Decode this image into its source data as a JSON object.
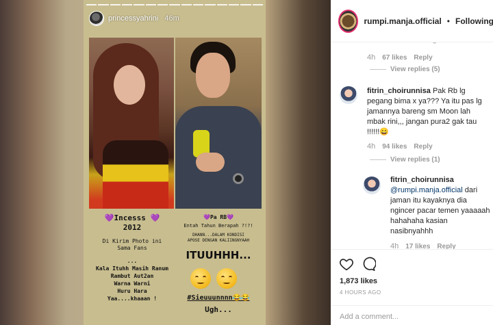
{
  "story": {
    "username": "princessyahrini",
    "time": "46m",
    "left_caption": {
      "title": "💜Incesss 💜\n2012",
      "line1": "Di Kirim Photo ini\nSama Fans",
      "line2": "...\nKala Ituhh Masih Ranum\nRambut Aut2an\nWarna Warni\nHuru Hara\nYaa....khaaan !"
    },
    "right_caption": {
      "title": "💜Pa RB💜",
      "line1": "Entah Tahun Berapah ?!?!",
      "line2": "DHANN...DALAM KONDISI\nAPOSE DENGAN KALIINGNYAAH",
      "big": "ITUUHHH...",
      "hashtag": "#Sieuuunnnn😂😂",
      "end": "Ugh..."
    }
  },
  "post": {
    "header": {
      "username": "rumpi.manja.official",
      "separator": "•",
      "follow_status": "Following"
    },
    "cut_text": "Zaman duluh mah gitu temen",
    "comments": [
      {
        "age": "4h",
        "likes": "67 likes",
        "reply": "Reply",
        "view_replies": "View replies (5)"
      },
      {
        "username": "fitrin_choirunnisa",
        "text": "Pak Rb lg pegang bima x ya??? Ya itu pas lg jamannya bareng sm Moon lah mbak rini,,, jangan pura2 gak tau !!!!!!😄",
        "age": "4h",
        "likes": "94 likes",
        "reply": "Reply",
        "view_replies": "View replies (1)"
      },
      {
        "username": "fitrin_choirunnisa",
        "mention": "@rumpi.manja.official",
        "text": "dari jaman itu kayaknya dia ngincer pacar temen yaaaaah hahahaha kasian nasibnyahhh",
        "age": "4h",
        "likes": "17 likes",
        "reply": "Reply"
      }
    ],
    "likes_count": "1,873 likes",
    "timestamp": "4 HOURS AGO",
    "add_comment_placeholder": "Add a comment..."
  }
}
